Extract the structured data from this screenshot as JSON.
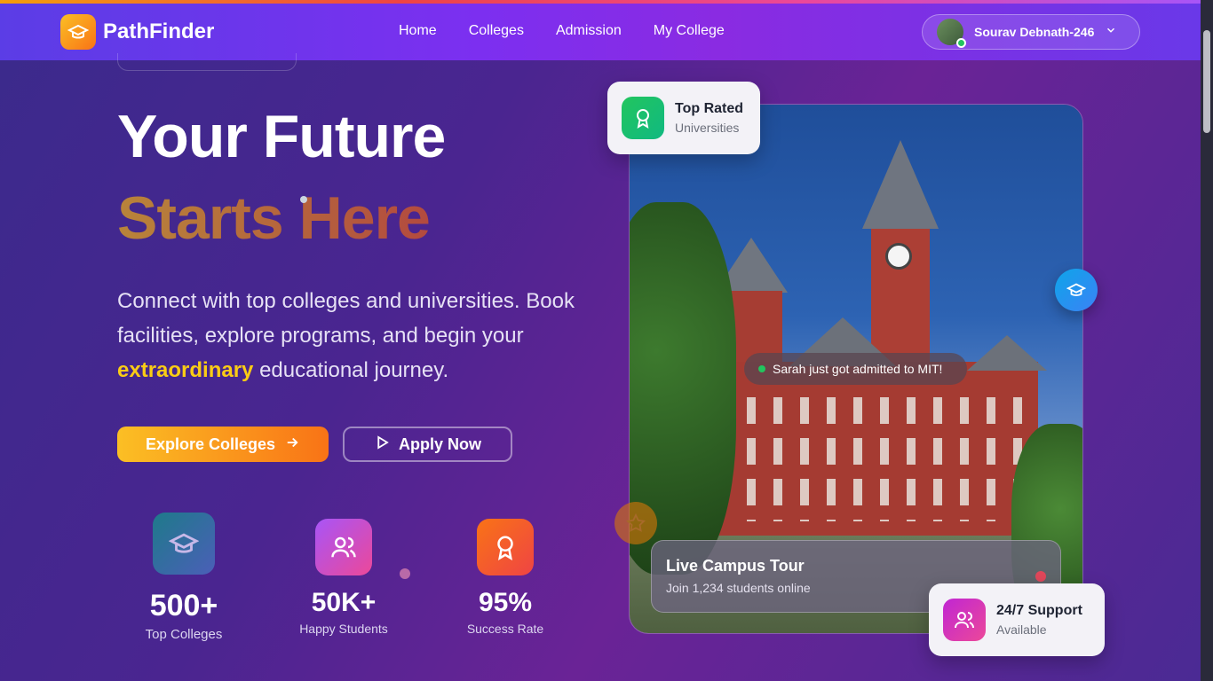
{
  "nav": {
    "brand": "PathFinder",
    "links": [
      "Home",
      "Colleges",
      "Admission",
      "My College"
    ],
    "user_name": "Sourav Debnath-246"
  },
  "hero": {
    "title_line1": "Your Future",
    "title_line2": "Starts Here",
    "desc_part1": "Connect with top colleges and universities. Book facilities, explore programs, and begin your ",
    "desc_highlight": "extraordinary",
    "desc_part2": " educational journey.",
    "explore_label": "Explore Colleges",
    "apply_label": "Apply Now"
  },
  "stats": [
    {
      "value": "500+",
      "label": "Top Colleges",
      "icon": "graduation-cap-icon"
    },
    {
      "value": "50K+",
      "label": "Happy Students",
      "icon": "users-icon"
    },
    {
      "value": "95%",
      "label": "Success Rate",
      "icon": "award-icon"
    }
  ],
  "cards": {
    "top_rated_title": "Top Rated",
    "top_rated_sub": "Universities",
    "toast": "Sarah just got admitted to MIT!",
    "tour_title": "Live Campus Tour",
    "tour_sub": "Join 1,234 students online",
    "support_title": "24/7 Support",
    "support_sub": "Available"
  },
  "colors": {
    "accent_orange": "#f97316",
    "accent_yellow": "#facc15",
    "online_green": "#22c55e"
  }
}
